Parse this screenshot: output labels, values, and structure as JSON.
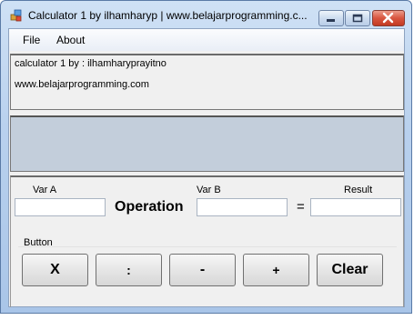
{
  "window": {
    "title": "Calculator 1 by ilhamharyp | www.belajarprogramming.c...",
    "app_icon": "app-icon",
    "controls": {
      "minimize": "minimize-icon",
      "maximize": "maximize-icon",
      "close": "close-icon"
    }
  },
  "menu": {
    "items": [
      "File",
      "About"
    ]
  },
  "info": {
    "line1": "calculator 1 by : ilhamharyprayitno",
    "line2": "www.belajarprogramming.com"
  },
  "operation_panel": {
    "var_a_label": "Var A",
    "var_a_value": "",
    "operation_label": "Operation",
    "var_b_label": "Var B",
    "var_b_value": "",
    "equals": "=",
    "result_label": "Result",
    "result_value": ""
  },
  "buttons": {
    "legend": "Button",
    "labels": [
      "X",
      ":",
      "-",
      "+",
      "Clear"
    ]
  },
  "colors": {
    "info_panel_bg": "#c3cedb",
    "client_bg": "#f0f0f0",
    "close_button": "#d8553f"
  }
}
